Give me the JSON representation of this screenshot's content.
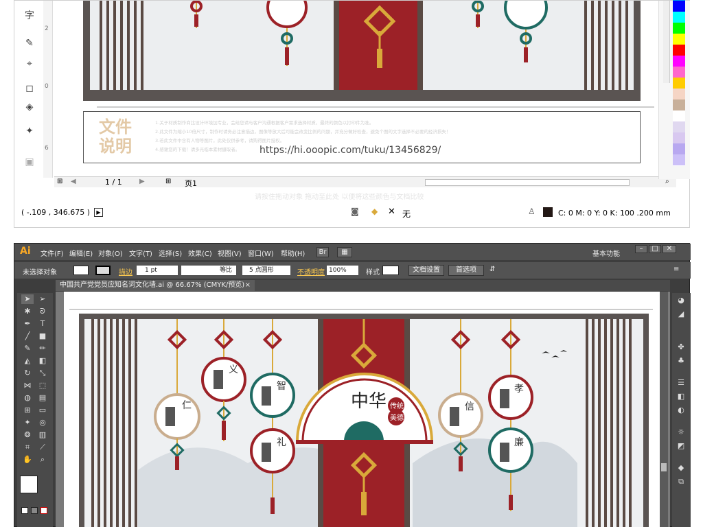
{
  "top_panel": {
    "type_tool_glyph": "字",
    "ruler_numbers": [
      "2",
      "0",
      "6"
    ],
    "notes_title_line1": "文件",
    "notes_title_line2": "说明",
    "notes_lines": [
      "1.关于材质制作商比设计环境加专业，会给您请与客户沟通根据客户需求选择材质，最终的颜色以打印件为准。",
      "2.此文件为缩小10倍尺寸，制作时请务必注意描边，图像等放大后可能会改变比例的问题，并充分做好检查，避免个图的文字选择不必要的经济损失！",
      "3.若此文件中含有人物等图片，此处仅供参考，请购得图片授权。",
      "4.感谢您的下载！请多光临本素材摄取者。"
    ],
    "url": "https://hi.ooopic.com/tuku/13456829/",
    "page_indicator": "1 / 1",
    "artboard_label": "页1",
    "status_hint": "请按住拖动对象 拖动至此处 以便将这些颜色与文档比较",
    "coordinates": "( -.109 , 346.675 )",
    "fill_none_label": "无",
    "cmyk_readout": "C: 0 M: 0 Y: 0 K: 100  .200 mm",
    "swatch_colors": [
      "#00a0e9",
      "#0000ff",
      "#00ffff",
      "#00ff00",
      "#ffff00",
      "#ff0000",
      "#ff00ff",
      "#ff66cc",
      "#ffcc00",
      "#f5d5c5",
      "#c8b09a",
      "#ffffff",
      "#e0d8f0",
      "#d8c8f0",
      "#b8a8f0",
      "#ccc0f8"
    ]
  },
  "ai_window": {
    "logo": "Ai",
    "menu": [
      "文件(F)",
      "编辑(E)",
      "对象(O)",
      "文字(T)",
      "选择(S)",
      "效果(C)",
      "视图(V)",
      "窗口(W)",
      "帮助(H)"
    ],
    "bridge_btn": "Br",
    "workspace": "基本功能",
    "control": {
      "no_selection": "未选择对象",
      "stroke_label": "描边",
      "stroke_value": "1 pt",
      "line_style": "等比",
      "brush": "5 点圆形",
      "opacity_label": "不透明度",
      "opacity_value": "100%",
      "style_label": "样式",
      "doc_setup": "文档设置",
      "preferences": "首选项"
    },
    "doc_tab": "中国共产党党员应知名词文化墙.ai @ 66.67% (CMYK/预览)",
    "close_tab": "×"
  },
  "artwork": {
    "center_title": "中华",
    "center_badge_1": "传统",
    "center_badge_2": "美德",
    "virtues": [
      "仁",
      "义",
      "智",
      "礼",
      "信",
      "孝",
      "廉"
    ]
  },
  "colors": {
    "wall_red": "#9c2127",
    "teal": "#1f6b63",
    "gold": "#d9a93a",
    "dark_brown": "#4f4541",
    "tan": "#c9ad8e"
  }
}
